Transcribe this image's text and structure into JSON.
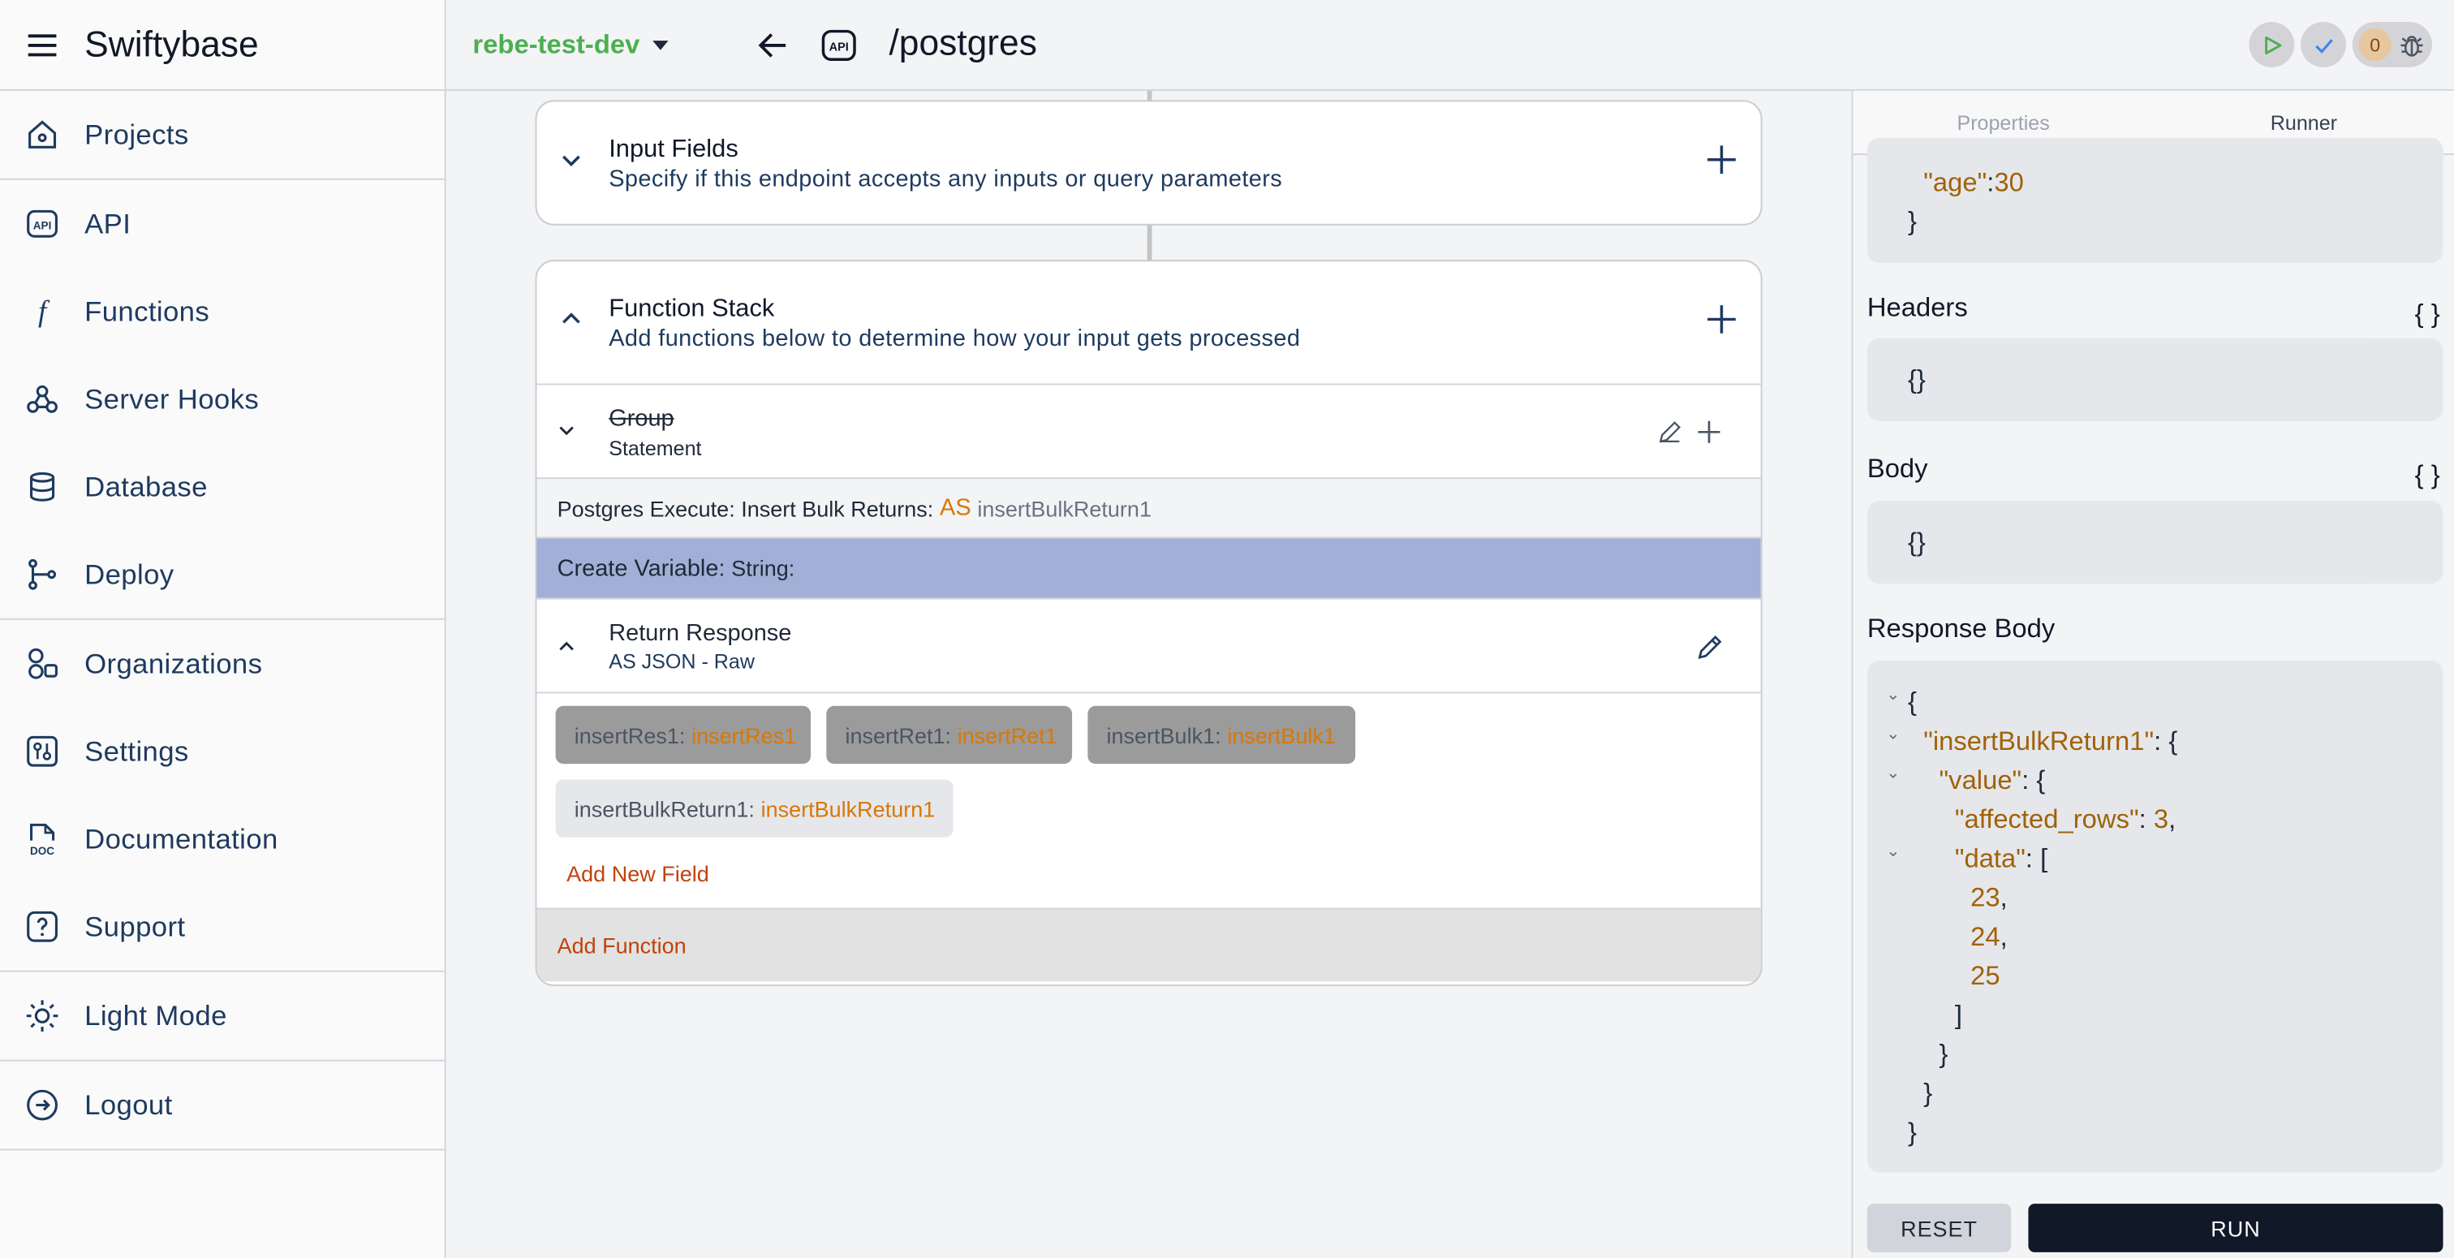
{
  "app": {
    "name": "Swiftybase"
  },
  "sidebar": {
    "groups": [
      [
        {
          "label": "Projects",
          "icon": "home-icon"
        }
      ],
      [
        {
          "label": "API",
          "icon": "api-icon"
        },
        {
          "label": "Functions",
          "icon": "function-icon"
        },
        {
          "label": "Server Hooks",
          "icon": "webhook-icon"
        },
        {
          "label": "Database",
          "icon": "database-icon"
        },
        {
          "label": "Deploy",
          "icon": "deploy-icon"
        }
      ],
      [
        {
          "label": "Organizations",
          "icon": "organizations-icon"
        },
        {
          "label": "Settings",
          "icon": "settings-icon"
        },
        {
          "label": "Documentation",
          "icon": "documentation-icon"
        },
        {
          "label": "Support",
          "icon": "help-icon"
        }
      ],
      [
        {
          "label": "Light Mode",
          "icon": "sun-icon"
        }
      ],
      [
        {
          "label": "Logout",
          "icon": "logout-icon"
        }
      ]
    ]
  },
  "topbar": {
    "project": "rebe-test-dev",
    "route": "/postgres",
    "issue_count": "0"
  },
  "canvas": {
    "input_fields": {
      "title": "Input Fields",
      "subtitle": "Specify if this endpoint accepts any inputs or query parameters"
    },
    "function_stack": {
      "title": "Function Stack",
      "subtitle": "Add functions below to determine how your input gets processed",
      "group": {
        "title": "Group",
        "subtitle": "Statement"
      },
      "postgres": {
        "label": "Postgres Execute: Insert Bulk Returns:",
        "as": "AS",
        "name": "insertBulkReturn1"
      },
      "create_variable": {
        "label": "Create Variable:",
        "type": "String:"
      },
      "return_response": {
        "title": "Return Response",
        "subtitle": "AS JSON - Raw"
      },
      "fields": [
        {
          "key": "insertRes1:",
          "value": "insertRes1"
        },
        {
          "key": "insertRet1:",
          "value": "insertRet1"
        },
        {
          "key": "insertBulk1:",
          "value": "insertBulk1"
        },
        {
          "key": "insertBulkReturn1:",
          "value": "insertBulkReturn1"
        }
      ],
      "add_field": "Add New Field",
      "add_function": "Add Function"
    }
  },
  "panel": {
    "tabs": [
      "Properties",
      "Runner"
    ],
    "active_tab": "Runner",
    "input_tail": {
      "key": "\"age\"",
      "value": "30"
    },
    "headers": {
      "title": "Headers",
      "braces": "{ }",
      "value": "{}"
    },
    "body": {
      "title": "Body",
      "braces": "{ }",
      "value": "{}"
    },
    "response": {
      "title": "Response Body",
      "root_key": "\"insertBulkReturn1\"",
      "value_key": "\"value\"",
      "affected_key": "\"affected_rows\"",
      "affected_value": "3",
      "data_key": "\"data\"",
      "data_values": [
        "23",
        "24",
        "25"
      ]
    },
    "reset_label": "RESET",
    "run_label": "RUN"
  },
  "colors": {
    "accent_orange": "#d97706",
    "project_green": "#4caf50",
    "selected_row": "#a2b0d8",
    "run_button": "#111827"
  }
}
